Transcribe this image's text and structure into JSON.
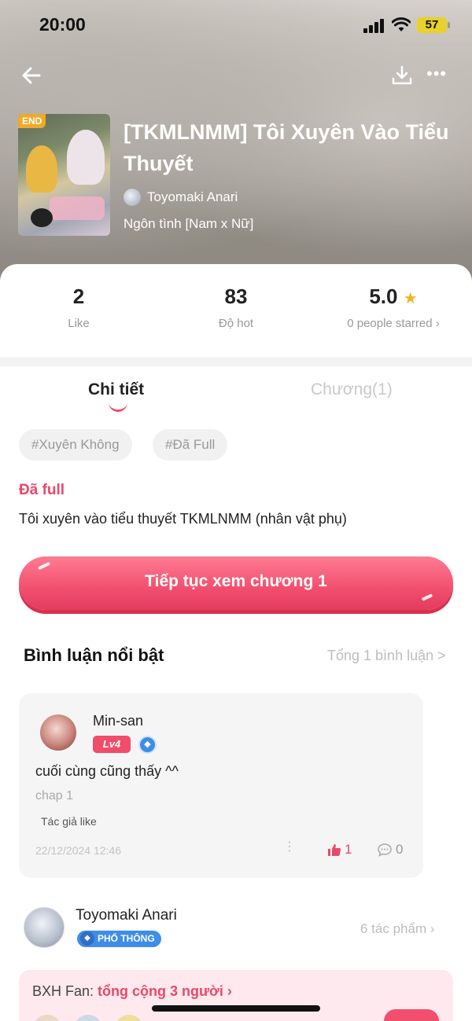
{
  "status_bar": {
    "time": "20:00",
    "battery": "57"
  },
  "book": {
    "cover_tag": "END",
    "title": "[TKMLNMM] Tôi Xuyên Vào Tiểu Thuyết",
    "author": "Toyomaki Anari",
    "genre": "Ngôn tình [Nam x Nữ]"
  },
  "stats": {
    "like_value": "2",
    "like_label": "Like",
    "hot_value": "83",
    "hot_label": "Độ hot",
    "rating_value": "5.0",
    "rating_label": "0 people starred ›"
  },
  "tabs": {
    "detail": "Chi tiết",
    "chapters": "Chương(1)"
  },
  "tags": [
    "#Xuyên Không",
    "#Đã Full"
  ],
  "status": "Đã full",
  "description": "Tôi xuyên vào tiểu thuyết TKMLNMM (nhân vật phụ)",
  "continue_button": "Tiếp tục xem chương 1",
  "comments_section": {
    "title": "Bình luận nổi bật",
    "total": "Tổng 1 bình luận >"
  },
  "comment": {
    "user": "Min-san",
    "level": "Lv4",
    "text": "cuối cùng cũng thấy ^^",
    "chapter": "chap 1",
    "author_like": "Tác giả like",
    "date": "22/12/2024 12:46",
    "likes": "1",
    "replies": "0"
  },
  "author_section": {
    "name": "Toyomaki Anari",
    "badge": "PHỔ THÔNG",
    "works": "6 tác phẩm ›"
  },
  "fan_rank": {
    "label": "BXH Fan: ",
    "highlight": "tổng cộng 3 người ›"
  },
  "colors": {
    "accent": "#e8496b",
    "badge_blue": "#3f8de8",
    "star": "#f5b31c"
  }
}
